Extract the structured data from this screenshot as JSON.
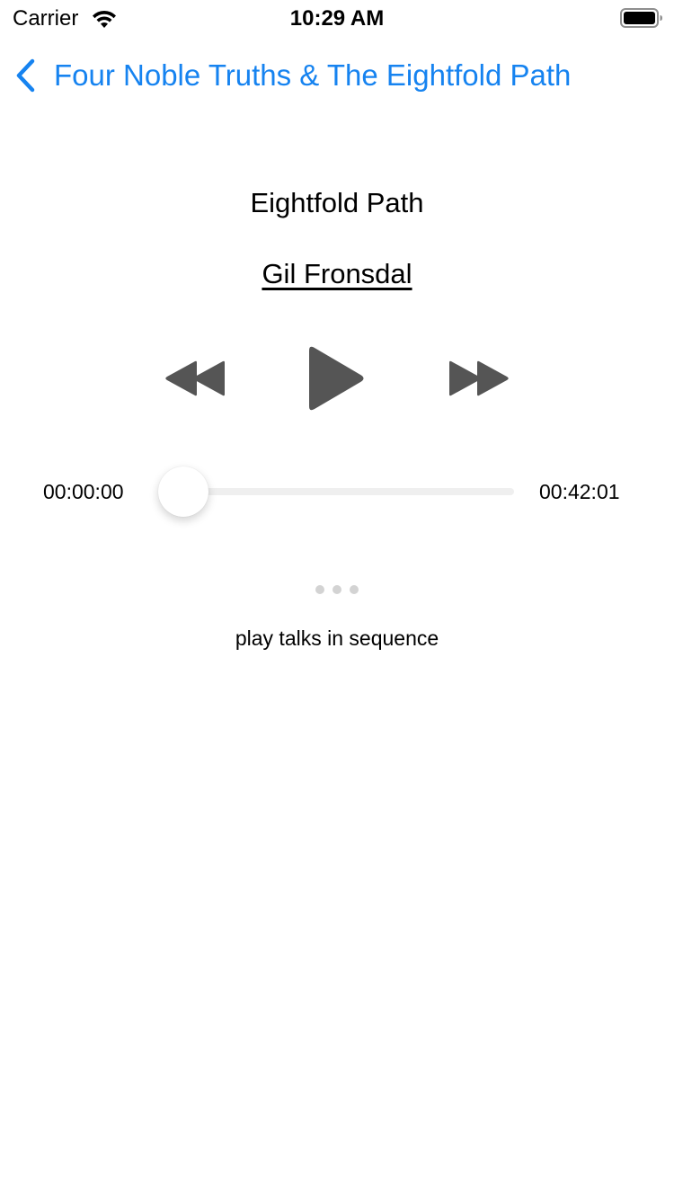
{
  "status_bar": {
    "carrier": "Carrier",
    "time": "10:29 AM",
    "icons": [
      "wifi-icon",
      "battery-icon"
    ]
  },
  "nav": {
    "back_label": "Four Noble Truths & The Eightfold Path",
    "back_icon": "back-chevron-icon",
    "accent_color": "#1683f0"
  },
  "talk": {
    "title": "Eightfold Path",
    "speaker": "Gil Fronsdal"
  },
  "controls": {
    "icons": [
      "rewind-icon",
      "play-icon",
      "fast-forward-icon"
    ],
    "icon_color": "#555555"
  },
  "progress": {
    "elapsed": "00:00:00",
    "total": "00:42:01",
    "fraction": 0
  },
  "sequence": {
    "label": "play talks in sequence"
  }
}
